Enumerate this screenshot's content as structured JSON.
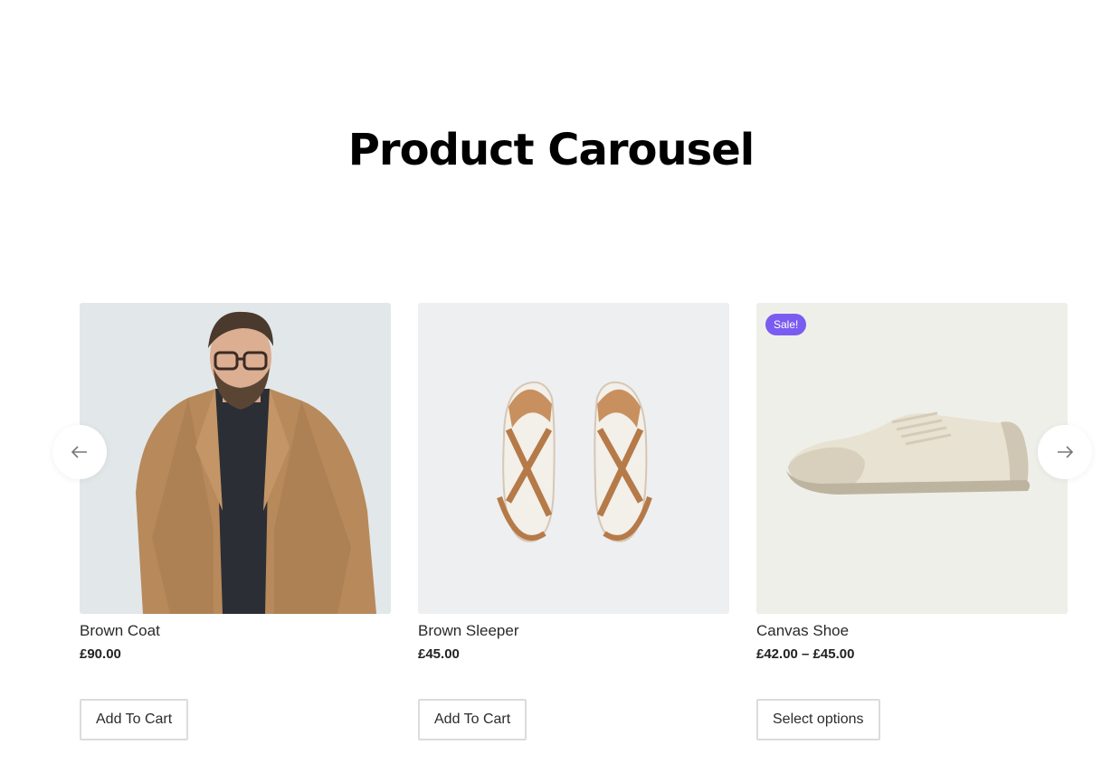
{
  "heading": "Product Carousel",
  "products": [
    {
      "name": "Brown Coat",
      "price": "£90.00",
      "button": "Add To Cart"
    },
    {
      "name": "Brown Sleeper",
      "price": "£45.00",
      "button": "Add To Cart"
    },
    {
      "name": "Canvas Shoe",
      "price": "£42.00 – £45.00",
      "button": "Select options",
      "badge": "Sale!"
    }
  ],
  "colors": {
    "badge": "#7b5cf0",
    "button_border": "#dcdcdc",
    "heading": "#000000"
  },
  "icons": {
    "prev": "arrow-left-icon",
    "next": "arrow-right-icon"
  }
}
